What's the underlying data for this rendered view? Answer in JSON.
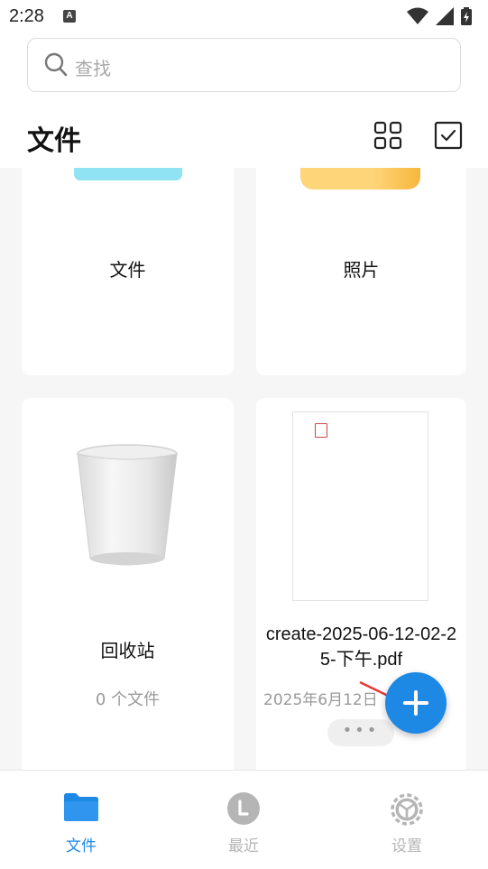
{
  "status_bar": {
    "time": "2:28",
    "notification_badge": "A"
  },
  "search": {
    "placeholder": "查找"
  },
  "header": {
    "title": "文件"
  },
  "cards": [
    {
      "label": "文件",
      "icon": "folder-cyan"
    },
    {
      "label": "照片",
      "icon": "folder-yellow"
    },
    {
      "label": "回收站",
      "subtitle": "0 个文件",
      "icon": "trash-can"
    },
    {
      "file_name": "create-2025-06-12-02-25-下午.pdf",
      "date": "2025年6月12日",
      "more_label": "•••",
      "icon": "pdf-thumbnail"
    }
  ],
  "fab": {
    "icon": "plus-icon"
  },
  "bottom_nav": [
    {
      "label": "文件",
      "icon": "folder-icon",
      "active": true
    },
    {
      "label": "最近",
      "icon": "clock-icon",
      "active": false
    },
    {
      "label": "设置",
      "icon": "gear-icon",
      "active": false
    }
  ],
  "colors": {
    "accent": "#1e88e5",
    "inactive": "#b5b5b5",
    "background": "#f6f6f7",
    "annotation_arrow": "#e53935"
  }
}
